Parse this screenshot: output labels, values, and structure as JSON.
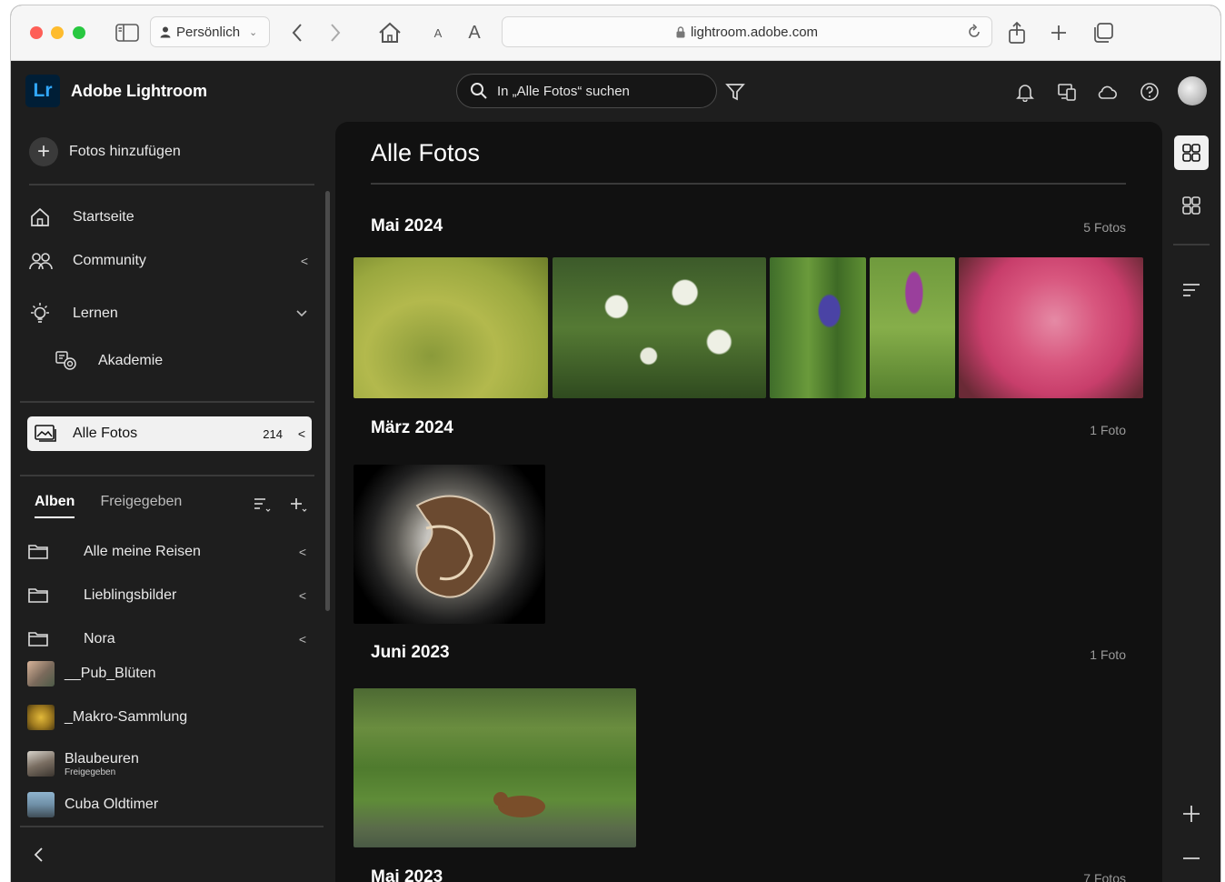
{
  "browser": {
    "profile": "Persönlich",
    "url": "lightroom.adobe.com",
    "font_small": "A",
    "font_large": "A"
  },
  "app": {
    "logo": "Lr",
    "title": "Adobe Lightroom",
    "search_placeholder": "In „Alle Fotos“ suchen"
  },
  "sidebar": {
    "add_photos": "Fotos hinzufügen",
    "nav": [
      {
        "label": "Startseite",
        "icon": "home-icon"
      },
      {
        "label": "Community",
        "icon": "community-icon"
      },
      {
        "label": "Lernen",
        "icon": "lightbulb-icon"
      },
      {
        "label": "Akademie",
        "icon": "academy-icon"
      }
    ],
    "all_photos": {
      "label": "Alle Fotos",
      "count": "214"
    },
    "tabs": [
      "Alben",
      "Freigegeben"
    ],
    "albums": [
      {
        "label": "Alle meine Reisen"
      },
      {
        "label": "Lieblingsbilder"
      },
      {
        "label": "Nora"
      },
      {
        "label": "__Pub_Blüten"
      },
      {
        "label": "_Makro-Sammlung"
      },
      {
        "label": "Blaubeuren",
        "sub": "Freigegeben"
      },
      {
        "label": "Cuba Oldtimer"
      }
    ]
  },
  "main": {
    "title": "Alle Fotos",
    "groups": [
      {
        "title": "Mai 2024",
        "count": "5 Fotos"
      },
      {
        "title": "März 2024",
        "count": "1 Foto"
      },
      {
        "title": "Juni 2023",
        "count": "1 Foto"
      },
      {
        "title": "Mai 2023",
        "count": "7 Fotos"
      }
    ]
  },
  "colors": {
    "accent_blue": "#31a8ff",
    "logo_bg": "#001e36",
    "panel_bg": "#1e1e1e",
    "grid_bg": "#111111"
  }
}
